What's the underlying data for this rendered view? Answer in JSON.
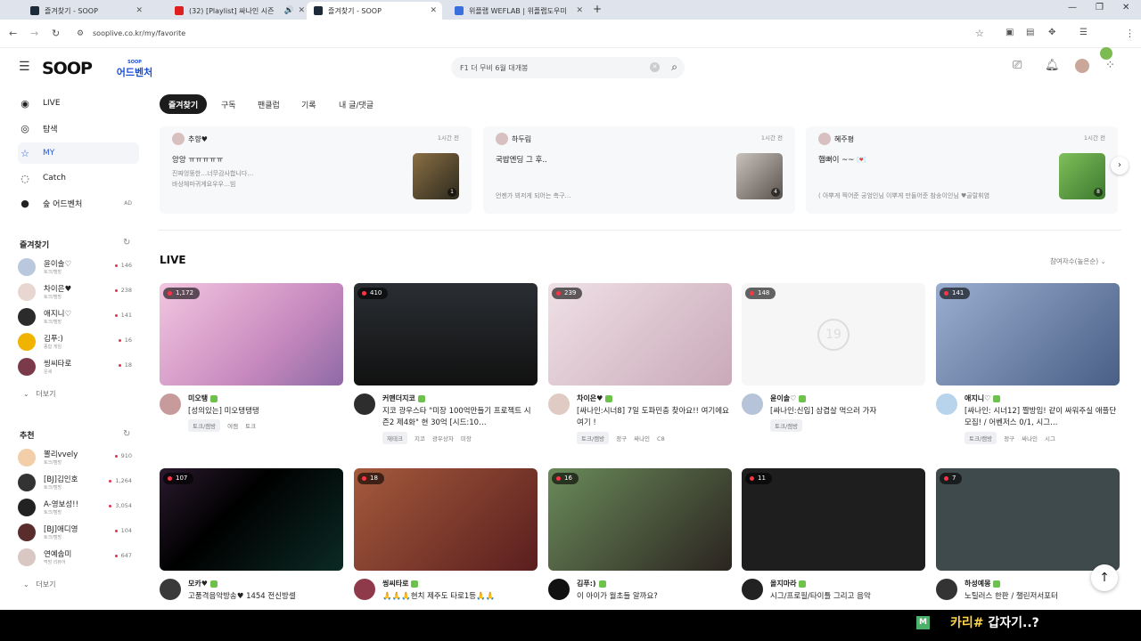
{
  "browser": {
    "tabs": [
      {
        "title": "즐겨찾기 - SOOP",
        "active": false
      },
      {
        "title": "(32) [Playlist] 싸나인 시즌",
        "active": false
      },
      {
        "title": "즐겨찾기 - SOOP",
        "active": true
      },
      {
        "title": "위플랩 WEFLAB | 위플랩도우미",
        "active": false
      }
    ],
    "url": "sooplive.co.kr/my/favorite"
  },
  "header": {
    "logo": "SOOP",
    "adventure_top": "SOOP",
    "adventure": "어드벤처",
    "search_value": "F1 더 무비 6월 대개봉"
  },
  "sidebar": {
    "nav": [
      {
        "label": "LIVE",
        "icon": "broadcast-icon"
      },
      {
        "label": "탐색",
        "icon": "compass-icon"
      },
      {
        "label": "MY",
        "icon": "star-icon"
      },
      {
        "label": "Catch",
        "icon": "catch-icon"
      },
      {
        "label": "숲 어드벤처",
        "icon": "soop-adventure-icon",
        "badge": "AD"
      }
    ],
    "favorites_title": "즐겨찾기",
    "favorites": [
      {
        "name": "윤이솔♡",
        "sub": "토크/캠방",
        "count": "146",
        "color": "#b9c8dc"
      },
      {
        "name": "차이은♥",
        "sub": "토크/캠방",
        "count": "238",
        "color": "#e8d6d0"
      },
      {
        "name": "애지니♡",
        "sub": "토크/캠방",
        "count": "141",
        "color": "#2b2b2b"
      },
      {
        "name": "김푸:)",
        "sub": "종합 게임",
        "count": "16",
        "color": "#f0b400"
      },
      {
        "name": "씽씨타로",
        "sub": "운세",
        "count": "18",
        "color": "#7a3a4a"
      }
    ],
    "more_label": "더보기",
    "recommend_title": "추천",
    "recommend": [
      {
        "name": "뽈리vvely",
        "sub": "토크/캠방",
        "count": "910",
        "color": "#f2cfa8"
      },
      {
        "name": "[BJ]김인호",
        "sub": "토크/캠방",
        "count": "1,264",
        "color": "#333"
      },
      {
        "name": "A-영보성!!",
        "sub": "토크/캠방",
        "count": "3,054",
        "color": "#222"
      },
      {
        "name": "[BJ]애디영",
        "sub": "토크/캠방",
        "count": "104",
        "color": "#5a2d2d"
      },
      {
        "name": "연예솜미",
        "sub": "먹방 리뷰어",
        "count": "647",
        "color": "#d8c7c2"
      }
    ]
  },
  "page_tabs": [
    "즐겨찾기",
    "구독",
    "팬클럽",
    "기록",
    "내 글/댓글"
  ],
  "posts": [
    {
      "author": "추향♥",
      "time": "1시간 전",
      "title": "앙앙 ㅠㅠㅠㅠㅠ",
      "body": "진짜엉뚱한…너무감사합니다…\n바상체마귀게요우우…빔",
      "thumb_count": "1",
      "thumb_color": "#6a5a3c"
    },
    {
      "author": "하두림",
      "time": "1시간 전",
      "title": "국밥엔딩 그 후..",
      "body": "언젠가 뵈저게 되어는 촉구…",
      "thumb_count": "4",
      "thumb_color": "#8a7a70"
    },
    {
      "author": "혜주평",
      "time": "1시간 전",
      "title": "햄뻐이 ~~ 💌",
      "body": "( 아뿌게 찍어준 궁엄인님 이뿌게 만들어준 참송이인님 ♥골랄휘염",
      "thumb_count": "8",
      "thumb_color": "#4a8a3c"
    }
  ],
  "live": {
    "title": "LIVE",
    "sort_label": "참여자수(높은순)",
    "cards": [
      {
        "viewers": "1,172",
        "name": "미오탱",
        "title": "[성의있는] 미오탱탱탱",
        "tags": [
          "토크/캠방",
          "여캠",
          "토크"
        ],
        "thumb": "#e8b9d6",
        "avatar": "#c79b9b"
      },
      {
        "viewers": "410",
        "name": "커맨더지코",
        "title": "지코 광우스타 \"미장 100억만들기 프로젝트 시즌2 제4화\" 현 30억 [시드:10…",
        "tags": [
          "재테크",
          "지코",
          "광우상자",
          "미장"
        ],
        "thumb": "#202428",
        "avatar": "#2d2d2d"
      },
      {
        "viewers": "239",
        "name": "차이은♥",
        "title": "[싸나인:시너8] 7일 도파민충 찾아요!! 여기에요여기 !",
        "tags": [
          "토크/캠방",
          "정구",
          "싸나인",
          "C8"
        ],
        "thumb": "#d9c4cf",
        "avatar": "#e0cbc4"
      },
      {
        "viewers": "148",
        "name": "윤이솔♡",
        "title": "[싸나인:신입] 삼겹살 먹으러 가자",
        "tags": [
          "토크/캠방"
        ],
        "thumb": "#f6f6f6",
        "avatar": "#b6c3d8",
        "age_mark": "19"
      },
      {
        "viewers": "141",
        "name": "애지니♡",
        "title": "[싸나인: 시너12] 짤방임! 같이 싸워주실 애플단 모집! / 어벤저스 0/1, 시그…",
        "tags": [
          "토크/캠방",
          "정구",
          "싸나인",
          "시그"
        ],
        "thumb": "#7b8fb4",
        "avatar": "#b8d4ec"
      },
      {
        "viewers": "107",
        "name": "모카♥",
        "title": "고품격음악방송♥ 1454 전신방셀",
        "tags": [],
        "thumb": "#111",
        "avatar": "#3a3a3a"
      },
      {
        "viewers": "18",
        "name": "씽씨타로",
        "title": "🙏🙏🙏현치 제주도 타로1등🙏🙏",
        "tags": [],
        "thumb": "#7a2e30",
        "avatar": "#8e3a4a"
      },
      {
        "viewers": "16",
        "name": "김푸:)",
        "title": "이 아이가 월초들 알까요?",
        "tags": [],
        "thumb": "#4b3a34",
        "avatar": "#111"
      },
      {
        "viewers": "11",
        "name": "올지마라",
        "title": "시그/프로필/타이틀 그리고 음악",
        "tags": [],
        "thumb": "#1e1e1e",
        "avatar": "#222"
      },
      {
        "viewers": "7",
        "name": "하성예몽",
        "title": "노틸러스 한판 / 챌린저서포터",
        "tags": [],
        "thumb": "#3f4a4d",
        "avatar": "#333"
      }
    ]
  },
  "overlay": {
    "badge": "M",
    "text_a": "카리#",
    "text_b": " 갑자기..?"
  }
}
